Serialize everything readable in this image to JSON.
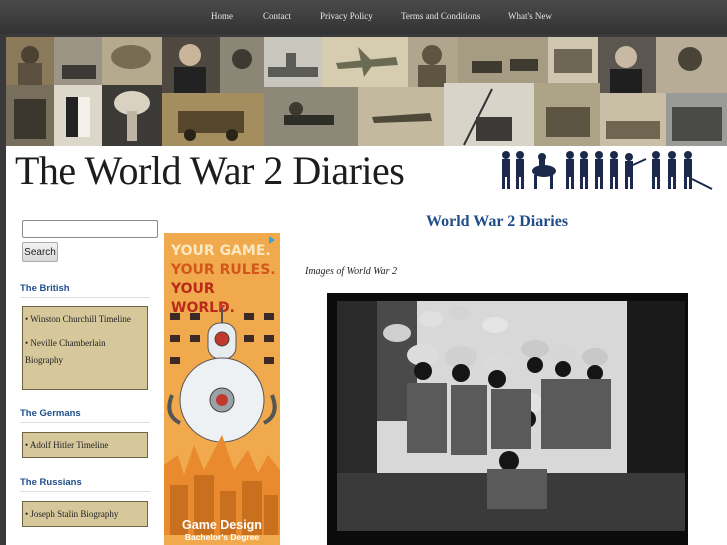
{
  "nav": {
    "items": [
      "Home",
      "Contact",
      "Privacy Policy",
      "Terms and Conditions",
      "What's New"
    ]
  },
  "header": {
    "title": "The World War 2 Diaries"
  },
  "search": {
    "placeholder": "",
    "button_label": "Search"
  },
  "sidebar": {
    "sections": [
      {
        "heading": "The British",
        "links": [
          "• Winston Churchill Timeline",
          "• Neville Chamberlain Biography"
        ]
      },
      {
        "heading": "The Germans",
        "links": [
          "• Adolf Hitler Timeline"
        ]
      },
      {
        "heading": "The Russians",
        "links": [
          "• Joseph Stalin Biography"
        ]
      }
    ]
  },
  "ad": {
    "line1": "YOUR GAME.",
    "line2": "YOUR RULES.",
    "line3": "YOUR WORLD.",
    "title": "Game Design",
    "subtitle": "Bachelor's Degree",
    "colors": {
      "background": "#f0a94c",
      "line1": "#fbe7c0",
      "line2": "#d4571a",
      "line3": "#b92a1a"
    }
  },
  "main": {
    "heading": "World War 2 Diaries",
    "caption": "Images of World War 2"
  },
  "colors": {
    "nav_bg": "#3a3a3a",
    "sidebar_box": "#d7c89c",
    "heading_blue": "#214c8a"
  }
}
